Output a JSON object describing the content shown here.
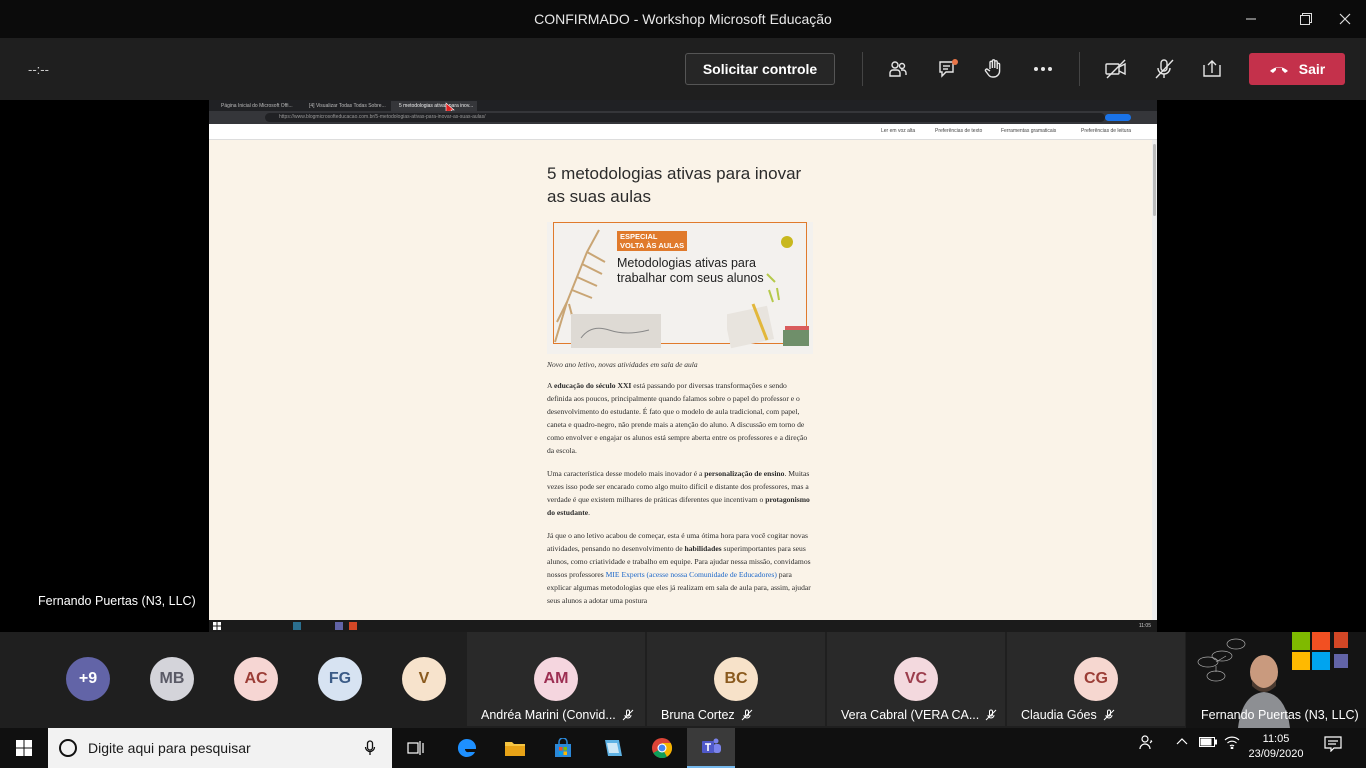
{
  "window": {
    "title": "CONFIRMADO - Workshop Microsoft Educação",
    "minimize": "—",
    "restore": "❐",
    "close": "✕"
  },
  "toolbar": {
    "timer": "--:--",
    "request_control_label": "Solicitar controle",
    "leave_label": "Sair",
    "icons": [
      "participants-icon",
      "chat-icon",
      "raise-hand-icon",
      "more-options-icon",
      "camera-off-icon",
      "mic-off-icon",
      "share-tray-icon"
    ]
  },
  "shared_screen": {
    "browser_tabs": [
      "Página Inicial do Microsoft Offi...",
      "[4] Visualizar Todas Todas Sobre...",
      "5 metodologias ativas para inov..."
    ],
    "url": "https://www.blogmicrosofteducacao.com.br/5-metodologias-ativas-para-inovar-as-suas-aulas/",
    "reader_items": [
      "Ler em voz alta",
      "Preferências de texto",
      "Ferramentas gramaticais",
      "Preferências de leitura"
    ],
    "article": {
      "title": "5 metodologias ativas para inovar as suas aulas",
      "hero_badge_line1": "ESPECIAL",
      "hero_badge_line2": "VOLTA ÀS AULAS",
      "hero_title": "Metodologias ativas para trabalhar com seus alunos",
      "caption": "Novo ano letivo, novas atividades em sala de aula",
      "p1_a": "A ",
      "p1_b": "educação do século XXI",
      "p1_c": " está passando por diversas transformações e sendo definida aos poucos, principalmente quando falamos sobre o papel do professor e o desenvolvimento do estudante. É fato que o modelo de aula tradicional, com papel, caneta e quadro-negro, não prende mais a atenção do aluno. A discussão em torno de como envolver e engajar os alunos está sempre aberta entre os professores e a direção da escola.",
      "p2_a": "Uma característica desse modelo mais inovador é a ",
      "p2_b": "personalização de ensino",
      "p2_c": ". Muitas vezes isso pode ser encarado como algo muito difícil e distante dos professores, mas a verdade é que existem milhares de práticas diferentes que incentivam o ",
      "p2_d": "protagonismo do estudante",
      "p2_e": ".",
      "p3_a": "Já que o ano letivo acabou de começar, esta é uma ótima hora para você cogitar novas atividades, pensando no desenvolvimento de ",
      "p3_b": "habilidades",
      "p3_c": " superimportantes para seus alunos, como criatividade e trabalho em equipe. Para ajudar nessa missão, convidamos nossos professores ",
      "p3_link": "MIE Experts (acesse nossa Comunidade de Educadores)",
      "p3_d": " para explicar algumas metodologias que eles já realizam em sala de aula para, assim, ajudar seus alunos a adotar uma postura"
    },
    "inner_clock": "11:05"
  },
  "presenter": "Fernando Puertas (N3, LLC)",
  "participants": {
    "overflow": "+9",
    "avatars": [
      {
        "initials": "MB",
        "bg": "#d4d4da",
        "fg": "#5a5a66"
      },
      {
        "initials": "AC",
        "bg": "#f6d6d3",
        "fg": "#9b3d36"
      },
      {
        "initials": "FG",
        "bg": "#d7e3f2",
        "fg": "#3b5b87"
      },
      {
        "initials": "V",
        "bg": "#f7e3cc",
        "fg": "#8a5a1e"
      }
    ],
    "tiles": [
      {
        "initials": "AM",
        "name": "Andréa Marini (Convid...",
        "bg": "#f5d6df",
        "fg": "#9c2e52"
      },
      {
        "initials": "BC",
        "name": "Bruna Cortez",
        "bg": "#f7e2c9",
        "fg": "#8a5a1e"
      },
      {
        "initials": "VC",
        "name": "Vera Cabral (VERA CA...",
        "bg": "#f3d9de",
        "fg": "#9b3d4c"
      },
      {
        "initials": "CG",
        "name": "Claudia Góes",
        "bg": "#f6d7d0",
        "fg": "#9b3d36"
      }
    ],
    "self_view_name": "Fernando Puertas (N3, LLC)"
  },
  "taskbar": {
    "search_placeholder": "Digite aqui para pesquisar",
    "time": "11:05",
    "date": "23/09/2020"
  },
  "colors": {
    "leave": "#c4314b",
    "overflow_avatar": "#6264a7",
    "accent_orange": "#e07a2c"
  }
}
